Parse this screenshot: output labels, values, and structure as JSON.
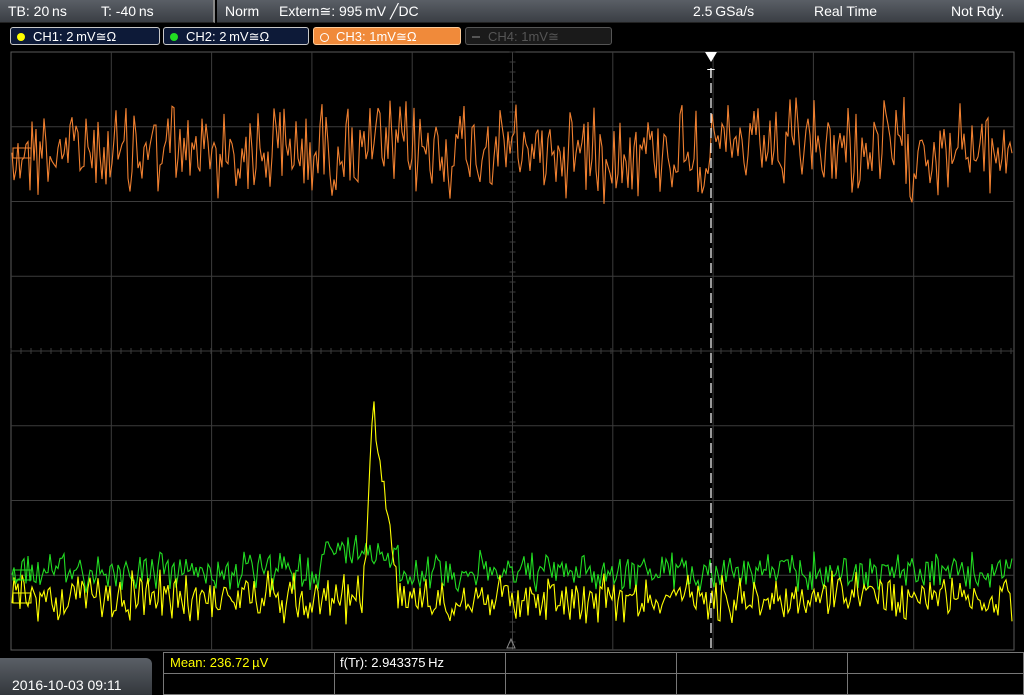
{
  "header": {
    "timebase": "TB: 20 ns",
    "trigger_time": "T: -40 ns",
    "trigger_mode": "Norm",
    "trigger_source": "Extern≅: 995 mV ╱DC",
    "sample_rate": "2.5 GSa/s",
    "acq_mode": "Real Time",
    "status": "Not Rdy."
  },
  "channels": [
    {
      "label": "CH1: 2 mV≅Ω",
      "color": "#ffff00",
      "active": true
    },
    {
      "label": "CH2: 2 mV≅Ω",
      "color": "#22dd22",
      "active": true
    },
    {
      "label": "CH3: 1mV≅Ω",
      "color": "#ffffff",
      "active": true,
      "selected": true
    },
    {
      "label": "CH4: 1mV≅",
      "color": "#555555",
      "active": false
    }
  ],
  "colors": {
    "ch1": "#ffff00",
    "ch2": "#22dd22",
    "ch3": "#f08030",
    "grid": "#3c3c3c"
  },
  "trigger_marker": "T",
  "measurements": {
    "mean": "Mean: 236.72 µV",
    "freq": "f(Tr): 2.943375 Hz"
  },
  "datetime": "2016-10-03 09:11"
}
